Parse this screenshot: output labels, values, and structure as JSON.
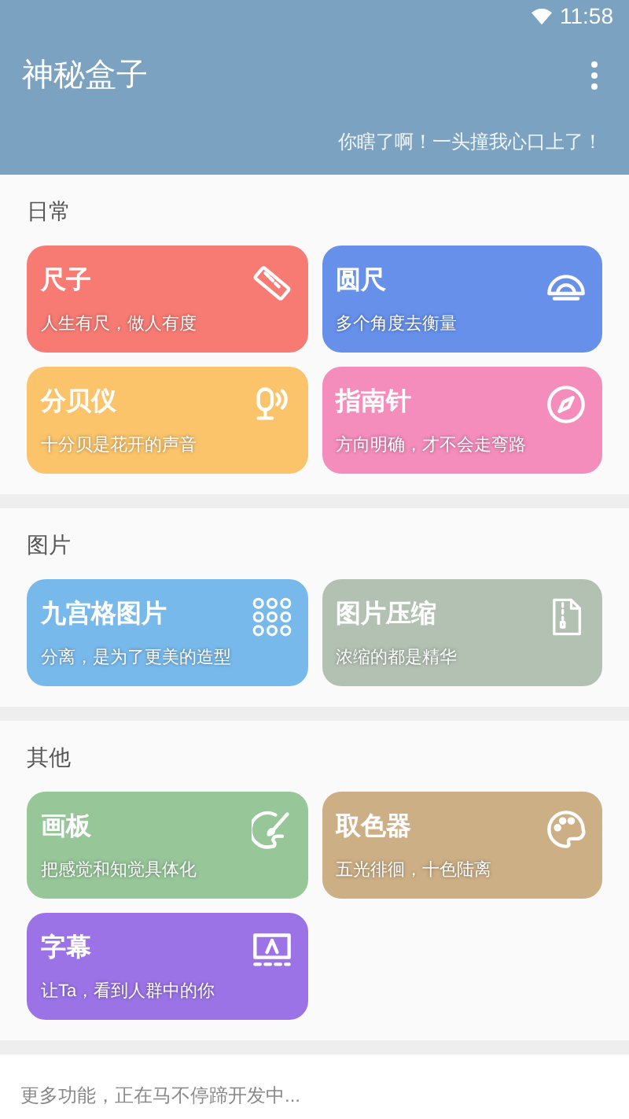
{
  "status_bar": {
    "time": "11:58"
  },
  "app_bar": {
    "title": "神秘盒子",
    "subtitle": "你瞎了啊！一头撞我心口上了！"
  },
  "sections": [
    {
      "title": "日常",
      "cards": [
        {
          "kind": "ruler",
          "title": "尺子",
          "subtitle": "人生有尺，做人有度",
          "color": "#f77b73"
        },
        {
          "kind": "protractor",
          "title": "圆尺",
          "subtitle": "多个角度去衡量",
          "color": "#6690ea"
        },
        {
          "kind": "decibel",
          "title": "分贝仪",
          "subtitle": "十分贝是花开的声音",
          "color": "#fbc46b"
        },
        {
          "kind": "compass",
          "title": "指南针",
          "subtitle": "方向明确，才不会走弯路",
          "color": "#f48cbc"
        }
      ]
    },
    {
      "title": "图片",
      "cards": [
        {
          "kind": "grid",
          "title": "九宫格图片",
          "subtitle": "分离，是为了更美的造型",
          "color": "#78b9ec"
        },
        {
          "kind": "zip",
          "title": "图片压缩",
          "subtitle": "浓缩的都是精华",
          "color": "#b3c1b3"
        }
      ]
    },
    {
      "title": "其他",
      "cards": [
        {
          "kind": "brush",
          "title": "画板",
          "subtitle": "把感觉和知觉具体化",
          "color": "#97c799"
        },
        {
          "kind": "palette",
          "title": "取色器",
          "subtitle": "五光徘徊，十色陆离",
          "color": "#cdaf86"
        },
        {
          "kind": "caption",
          "title": "字幕",
          "subtitle": "让Ta，看到人群中的你",
          "color": "#9b73e7"
        }
      ]
    }
  ],
  "footer": "更多功能，正在马不停蹄开发中..."
}
